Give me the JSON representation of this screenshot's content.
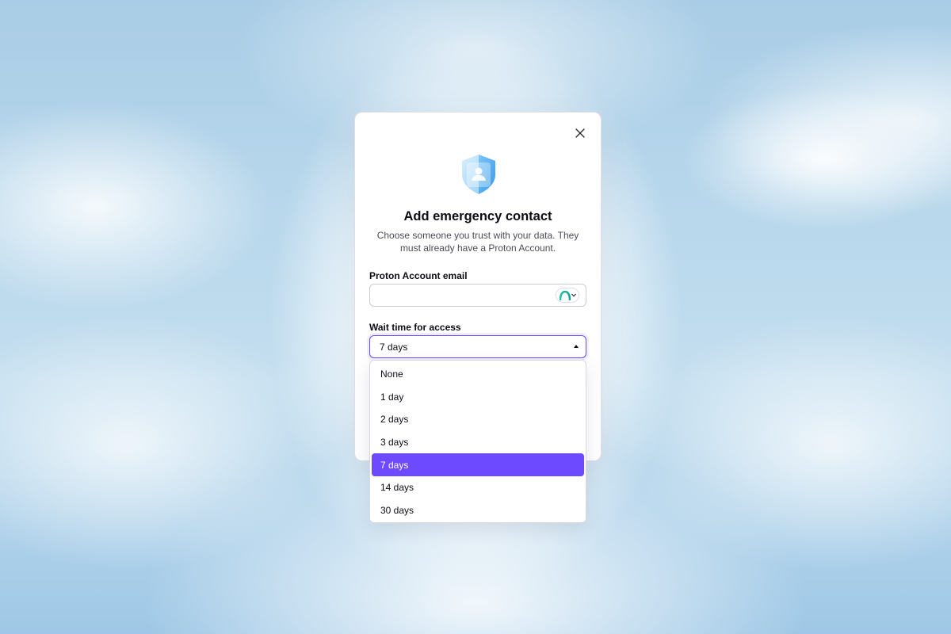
{
  "modal": {
    "title": "Add emergency contact",
    "subtitle": "Choose someone you trust with your data. They must already have a Proton Account.",
    "email_field": {
      "label": "Proton Account email",
      "value": "",
      "placeholder": "",
      "suffix_icon": "proton-logo-icon"
    },
    "wait_time": {
      "label": "Wait time for access",
      "selected": "7 days",
      "options": [
        "None",
        "1 day",
        "2 days",
        "3 days",
        "7 days",
        "14 days",
        "30 days"
      ]
    }
  },
  "colors": {
    "accent": "#6d4aff",
    "text": "#0c0c14",
    "muted": "#4a4b57",
    "shield_light": "#bfe3fb",
    "shield_dark": "#3ba2f0"
  }
}
